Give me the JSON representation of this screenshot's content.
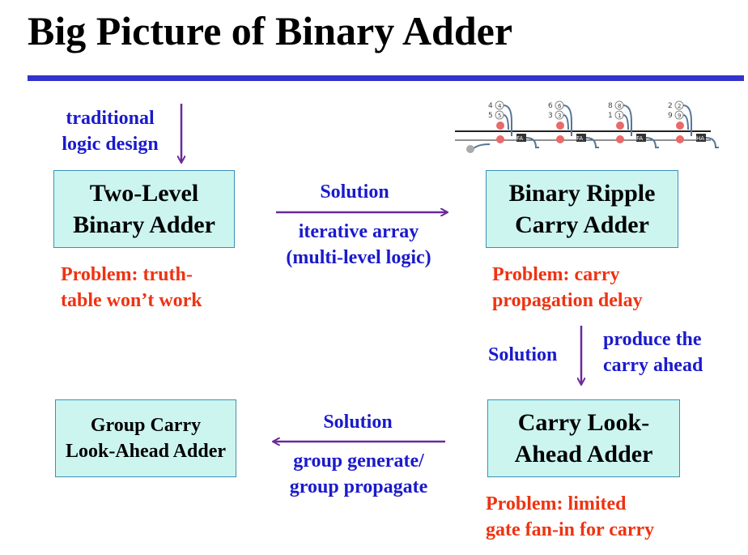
{
  "title": "Big Picture of Binary Adder",
  "colors": {
    "rule": "#3333cc",
    "box_fill": "#ccf5f0",
    "box_border": "#3b8fb8",
    "solution_text": "#1a1acc",
    "problem_text": "#ee3311",
    "arrow": "#6a2a9a"
  },
  "traditional": [
    "traditional",
    "logic design"
  ],
  "boxes": {
    "two_level": [
      "Two-Level",
      "Binary Adder"
    ],
    "ripple": [
      "Binary Ripple",
      "Carry Adder"
    ],
    "cla": [
      "Carry Look-",
      "Ahead Adder"
    ],
    "group": [
      "Group Carry",
      "Look-Ahead Adder"
    ]
  },
  "transitions": {
    "top": {
      "label": "Solution",
      "detail": [
        "iterative array",
        "(multi-level logic)"
      ]
    },
    "right": {
      "label": "Solution",
      "detail": [
        "produce the",
        "carry ahead"
      ]
    },
    "bottom": {
      "label": "Solution",
      "detail": [
        "group generate/",
        "group propagate"
      ]
    }
  },
  "problems": {
    "two_level": [
      "Problem:  truth-",
      "table won’t work"
    ],
    "ripple": [
      "Problem:  carry",
      "propagation delay"
    ],
    "cla": [
      "Problem:  limited",
      "gate fan-in for carry"
    ]
  },
  "ripple_figure": {
    "stages": [
      {
        "top": "4",
        "bottom": "5",
        "circle_top": "4",
        "circle_bottom": "5"
      },
      {
        "top": "6",
        "bottom": "3",
        "circle_top": "6",
        "circle_bottom": "3"
      },
      {
        "top": "8",
        "bottom": "1",
        "circle_top": "8",
        "circle_bottom": "1"
      },
      {
        "top": "2",
        "bottom": "9",
        "circle_top": "2",
        "circle_bottom": "9"
      }
    ],
    "fa_label": "FA",
    "ha_label": "HA"
  }
}
